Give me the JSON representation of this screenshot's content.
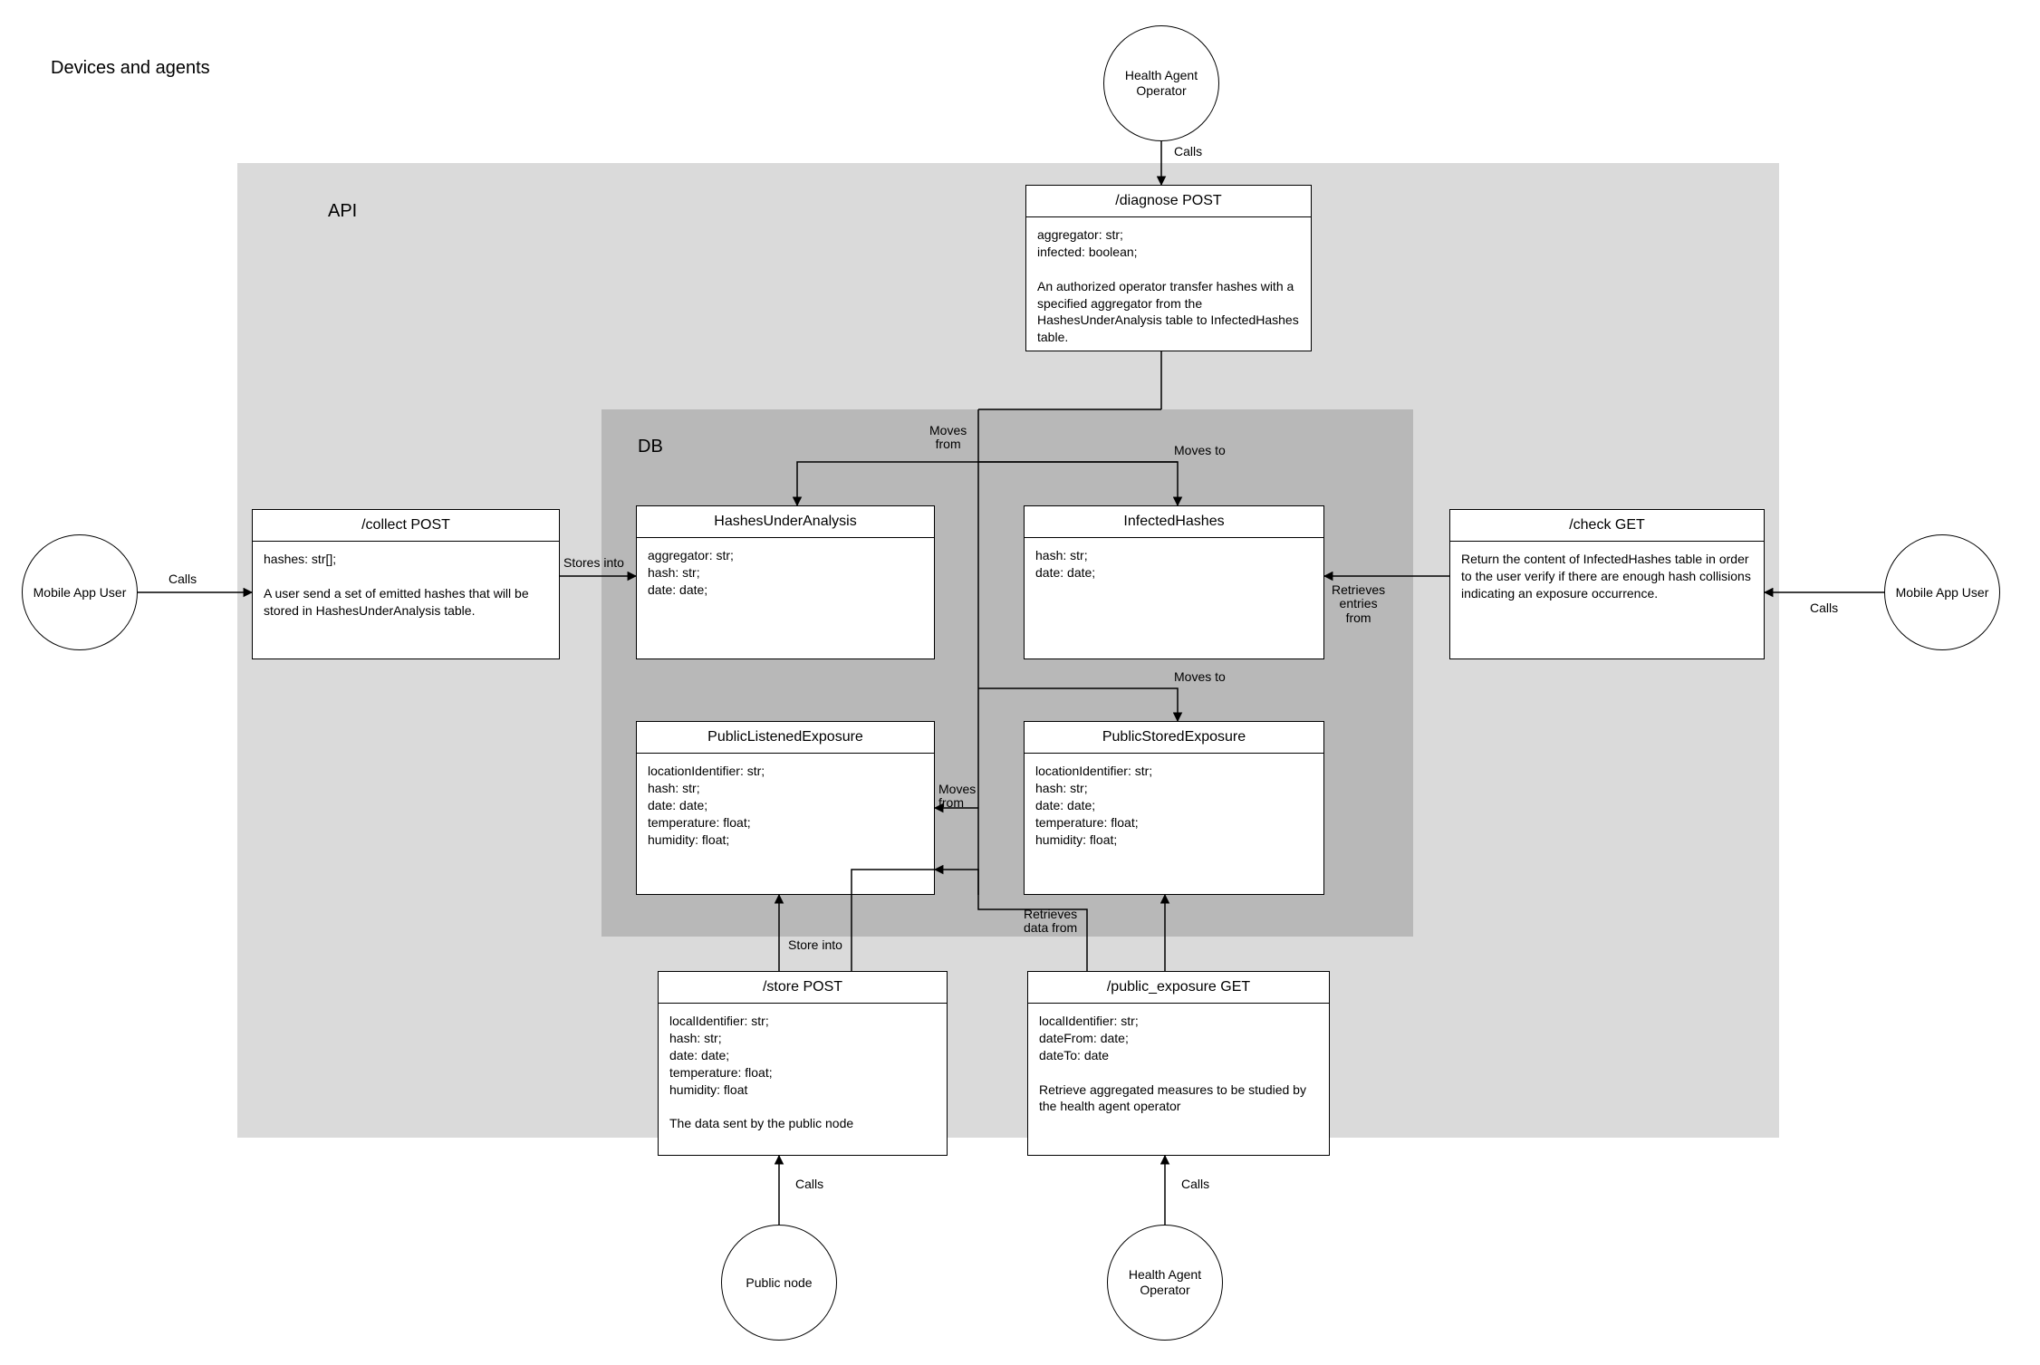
{
  "page_title": "Devices and agents",
  "regions": {
    "api": "API",
    "db": "DB"
  },
  "actors": {
    "mobile_left": "Mobile App User",
    "mobile_right": "Mobile App User",
    "health_top": "Health Agent\nOperator",
    "public_node": "Public node",
    "health_bottom": "Health Agent\nOperator"
  },
  "boxes": {
    "collect": {
      "title": "/collect POST",
      "body": "hashes: str[];\n\nA user send a set of emitted hashes that will be stored in HashesUnderAnalysis table."
    },
    "diagnose": {
      "title": "/diagnose POST",
      "body": "aggregator: str;\ninfected: boolean;\n\nAn authorized operator transfer hashes with a specified aggregator from the HashesUnderAnalysis table to InfectedHashes table."
    },
    "check": {
      "title": "/check GET",
      "body": "Return the content of InfectedHashes table in order to the user verify if there are enough hash collisions indicating an exposure occurrence."
    },
    "store": {
      "title": "/store POST",
      "body": "localIdentifier: str;\nhash: str;\ndate: date;\ntemperature: float;\nhumidity: float\n\nThe data sent by the public node"
    },
    "public_exposure": {
      "title": "/public_exposure GET",
      "body": "localIdentifier: str;\ndateFrom: date;\ndateTo: date\n\nRetrieve aggregated measures to be studied by the health agent operator"
    },
    "hashes_under_analysis": {
      "title": "HashesUnderAnalysis",
      "body": "aggregator: str;\nhash: str;\ndate: date;"
    },
    "infected_hashes": {
      "title": "InfectedHashes",
      "body": "hash: str;\ndate: date;"
    },
    "public_listened": {
      "title": "PublicListenedExposure",
      "body": "locationIdentifier: str;\nhash: str;\ndate: date;\ntemperature: float;\nhumidity: float;"
    },
    "public_stored": {
      "title": "PublicStoredExposure",
      "body": "locationIdentifier: str;\nhash: str;\ndate: date;\ntemperature: float;\nhumidity: float;"
    }
  },
  "edges": {
    "calls_top": "Calls",
    "calls_left": "Calls",
    "calls_right": "Calls",
    "calls_public": "Calls",
    "calls_health": "Calls",
    "stores_into": "Stores into",
    "moves_from_top": "Moves\nfrom",
    "moves_to_top": "Moves to",
    "moves_to_mid": "Moves to",
    "moves_from_mid": "Moves\nfrom",
    "retrieves_entries": "Retrieves\nentries\nfrom",
    "retrieves_data": "Retrieves\ndata from",
    "store_into_bottom": "Store into"
  }
}
